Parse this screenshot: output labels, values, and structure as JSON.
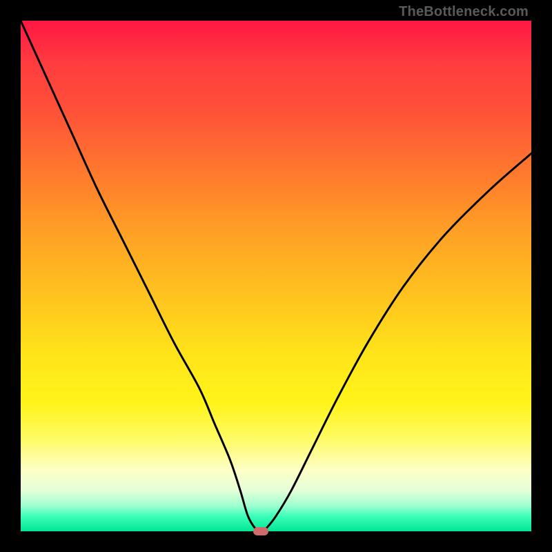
{
  "watermark": "TheBottleneck.com",
  "chart_data": {
    "type": "line",
    "title": "",
    "xlabel": "",
    "ylabel": "",
    "xlim": [
      0,
      100
    ],
    "ylim": [
      0,
      100
    ],
    "grid": false,
    "legend": false,
    "series": [
      {
        "name": "bottleneck-curve",
        "x": [
          0,
          5,
          10,
          15,
          20,
          25,
          30,
          35,
          38,
          41,
          43,
          44.5,
          46,
          47,
          48,
          50,
          53,
          57,
          62,
          68,
          75,
          83,
          92,
          100
        ],
        "y": [
          100,
          89,
          78,
          67,
          57,
          47,
          37,
          28,
          21,
          14,
          8,
          3,
          0.5,
          0,
          0.5,
          3,
          8,
          16,
          26,
          37,
          48,
          58,
          67,
          74
        ]
      }
    ],
    "marker": {
      "x": 47,
      "y": 0,
      "color": "#d16a6a"
    },
    "background_gradient": {
      "top": "#ff1744",
      "mid": "#ffe31a",
      "bottom": "#00e693"
    }
  }
}
